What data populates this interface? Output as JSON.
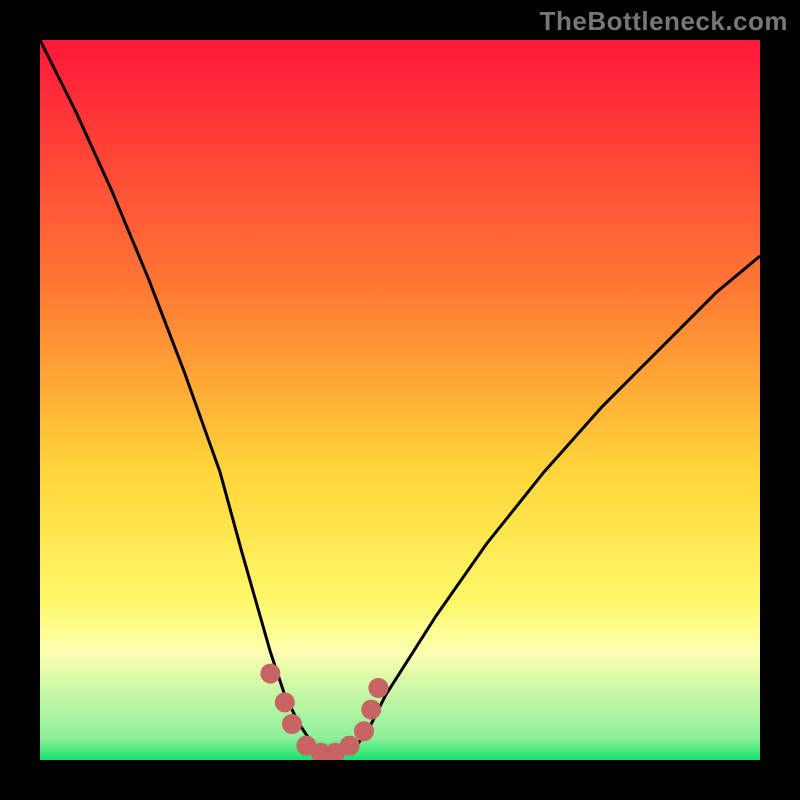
{
  "watermark": "TheBottleneck.com",
  "palette": {
    "gradient_top": "#ff173a",
    "gradient_mid1": "#ff7a34",
    "gradient_mid2": "#ffd63a",
    "gradient_mid3": "#fff86a",
    "gradient_band": "#fdffb0",
    "gradient_green": "#13e36b",
    "curve": "#000000",
    "marker": "#c86464"
  },
  "chart_data": {
    "type": "line",
    "title": "",
    "xlabel": "",
    "ylabel": "",
    "xlim": [
      0,
      100
    ],
    "ylim": [
      0,
      100
    ],
    "series": [
      {
        "name": "curve",
        "x": [
          0,
          5,
          10,
          15,
          20,
          25,
          28,
          30,
          32,
          34,
          36,
          38,
          40,
          42,
          44,
          46,
          48,
          55,
          62,
          70,
          78,
          86,
          94,
          100
        ],
        "y": [
          100,
          90,
          79,
          67,
          54,
          40,
          29,
          22,
          15,
          9,
          5,
          2,
          1,
          1,
          2,
          5,
          9,
          20,
          30,
          40,
          49,
          57,
          65,
          70
        ]
      }
    ],
    "markers": {
      "name": "highlight-points",
      "x": [
        32,
        34,
        35,
        37,
        39,
        41,
        43,
        45,
        46,
        47
      ],
      "y": [
        12,
        8,
        5,
        2,
        1,
        1,
        2,
        4,
        7,
        10
      ]
    },
    "gradient_stops": [
      {
        "pos": 0.0,
        "color": "#ff173a"
      },
      {
        "pos": 0.35,
        "color": "#ff7a34"
      },
      {
        "pos": 0.6,
        "color": "#ffd63a"
      },
      {
        "pos": 0.78,
        "color": "#fff86a"
      },
      {
        "pos": 0.85,
        "color": "#fdffb0"
      },
      {
        "pos": 0.97,
        "color": "#8cf09a"
      },
      {
        "pos": 1.0,
        "color": "#13e36b"
      }
    ]
  }
}
